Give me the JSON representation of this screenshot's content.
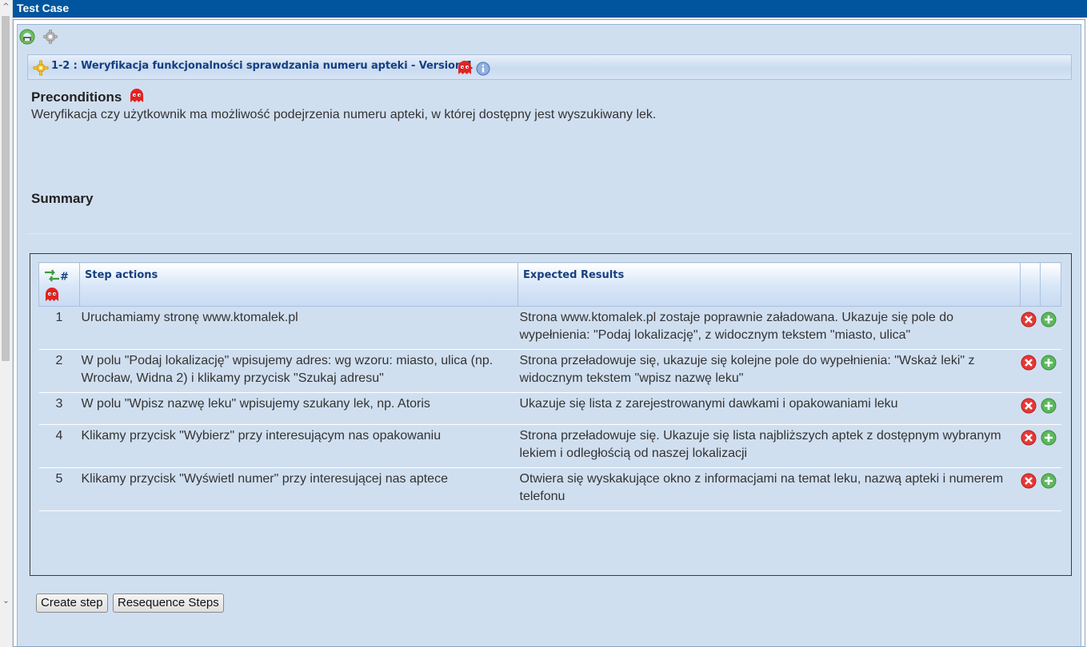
{
  "window": {
    "title": "Test Case"
  },
  "toolbar": {
    "icons": [
      "printer-icon",
      "gear-icon"
    ]
  },
  "header": {
    "title": "1-2 : Weryfikacja funkcjonalności sprawdzania numeru apteki - Version 1",
    "icons": [
      "gear-star-icon",
      "ghost-icon",
      "info-icon"
    ]
  },
  "preconditions": {
    "heading": "Preconditions",
    "text": "Weryfikacja czy użytkownik ma możliwość podejrzenia numeru apteki, w której dostępny jest wyszukiwany lek."
  },
  "summary": {
    "heading": "Summary"
  },
  "steps_table": {
    "columns": {
      "number": "#",
      "actions": "Step actions",
      "expected": "Expected Results"
    },
    "rows": [
      {
        "num": "1",
        "action": "Uruchamiamy stronę www.ktomalek.pl",
        "expected": "Strona www.ktomalek.pl zostaje poprawnie załadowana. Ukazuje się pole do wypełnienia: \"Podaj lokalizację\", z widocznym tekstem \"miasto, ulica\""
      },
      {
        "num": "2",
        "action": "W polu \"Podaj lokalizację\" wpisujemy adres: wg wzoru: miasto, ulica (np. Wrocław, Widna 2) i klikamy przycisk \"Szukaj adresu\"",
        "expected": "Strona przeładowuje się, ukazuje się kolejne pole do wypełnienia: \"Wskaż leki\" z widocznym tekstem \"wpisz nazwę leku\""
      },
      {
        "num": "3",
        "action": "W polu \"Wpisz nazwę leku\" wpisujemy szukany lek, np. Atoris",
        "expected": "Ukazuje się lista z zarejestrowanymi dawkami i opakowaniami leku"
      },
      {
        "num": "4",
        "action": "Klikamy przycisk \"Wybierz\" przy interesującym nas opakowaniu",
        "expected": "Strona przeładowuje się. Ukazuje się lista najbliższych aptek z dostępnym wybranym lekiem i odległością od naszej lokalizacji"
      },
      {
        "num": "5",
        "action": "Klikamy przycisk \"Wyświetl numer\" przy interesującej nas aptece",
        "expected": "Otwiera się wyskakujące okno z informacjami na temat leku, nazwą apteki i numerem telefonu"
      }
    ]
  },
  "buttons": {
    "create_step": "Create step",
    "resequence": "Resequence Steps"
  },
  "colors": {
    "titlebar": "#00559e",
    "panel_bg": "#d0dff0",
    "header_text": "#163f82",
    "delete": "#e53935",
    "add": "#5cb85c"
  }
}
